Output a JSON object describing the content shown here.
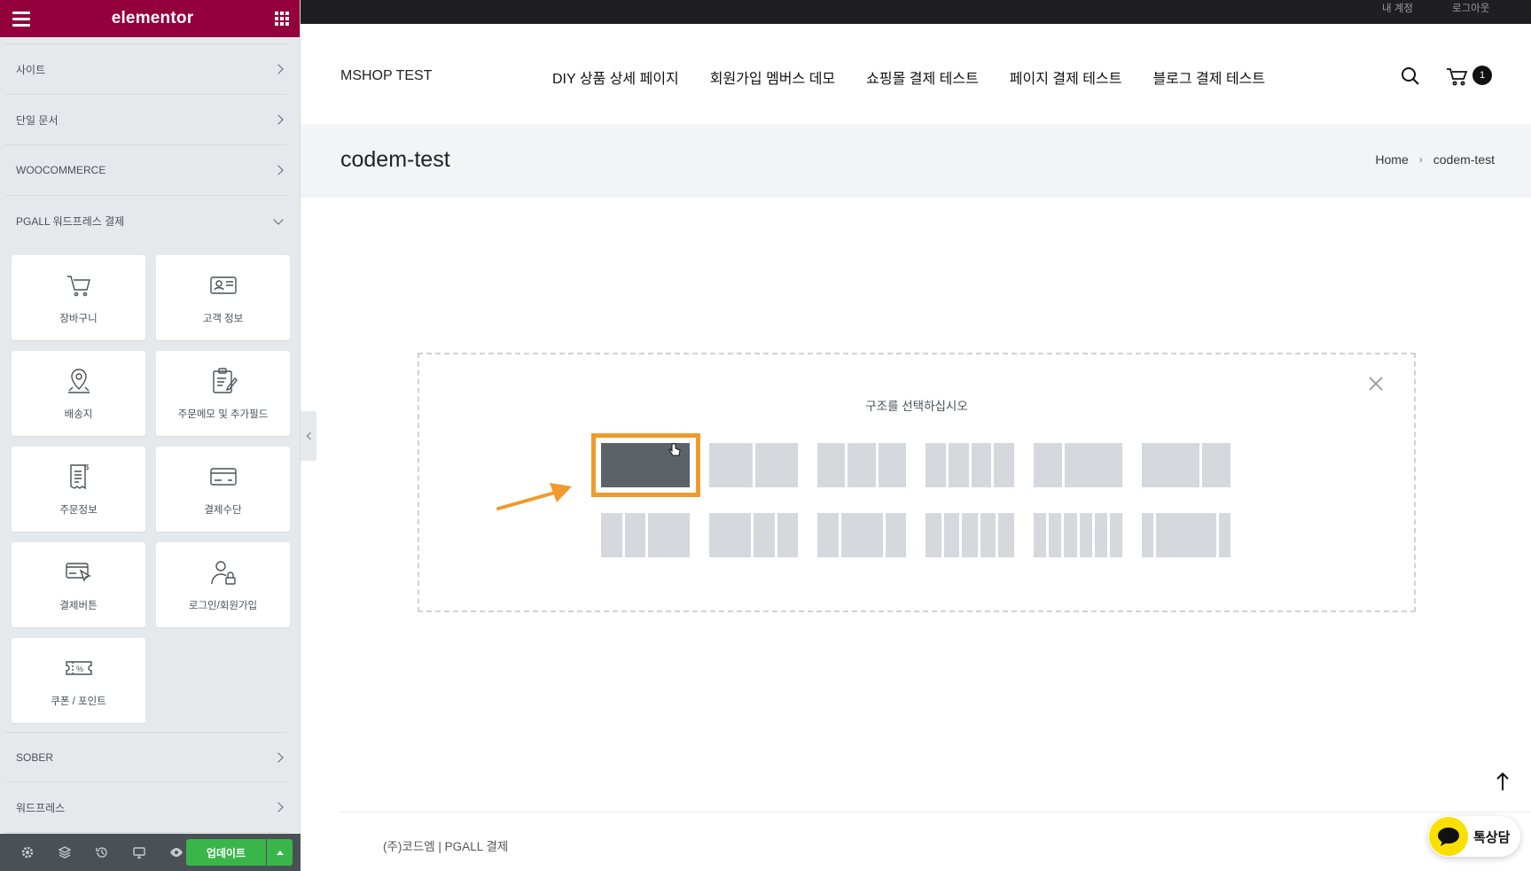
{
  "panel": {
    "logo": "elementor",
    "categories_top": [
      {
        "label": "사이트"
      },
      {
        "label": "단일 문서"
      },
      {
        "label": "WOOCOMMERCE"
      },
      {
        "label": "PGALL 워드프레스 결제"
      }
    ],
    "widgets": [
      {
        "label": "장바구니",
        "icon": "cart-icon"
      },
      {
        "label": "고객 정보",
        "icon": "id-card-icon"
      },
      {
        "label": "배송지",
        "icon": "location-pin-icon"
      },
      {
        "label": "주문메모 및 추가필드",
        "icon": "clipboard-edit-icon"
      },
      {
        "label": "주문정보",
        "icon": "receipt-icon"
      },
      {
        "label": "결제수단",
        "icon": "credit-card-icon"
      },
      {
        "label": "결제버튼",
        "icon": "payment-click-icon"
      },
      {
        "label": "로그인/회원가입",
        "icon": "user-lock-icon"
      },
      {
        "label": "쿠폰 / 포인트",
        "icon": "coupon-icon"
      }
    ],
    "categories_bottom": [
      {
        "label": "SOBER"
      },
      {
        "label": "워드프레스"
      }
    ],
    "footer": {
      "update_label": "업데이트",
      "icons": [
        "settings-icon",
        "layers-icon",
        "history-icon",
        "responsive-icon",
        "preview-eye-icon"
      ]
    }
  },
  "site": {
    "topbar": {
      "account": "내 계정",
      "logout": "로그아웃"
    },
    "title": "MSHOP TEST",
    "nav": [
      "DIY 상품 상세 페이지",
      "회원가입 멤버스 데모",
      "쇼핑몰 결제 테스트",
      "페이지 결제 테스트",
      "블로그 결제 테스트"
    ],
    "cart_count": "1",
    "page_title": "codem-test",
    "breadcrumb": {
      "home": "Home",
      "current": "codem-test"
    },
    "footer_text": "(주)코드엠 | PGALL 결제",
    "chat_label": "톡상담"
  },
  "structure": {
    "title": "구조를 선택하십시오",
    "selected_index": 0
  },
  "colors": {
    "brand": "#93003c",
    "highlight": "#f09a2c",
    "update": "#39b54a"
  }
}
